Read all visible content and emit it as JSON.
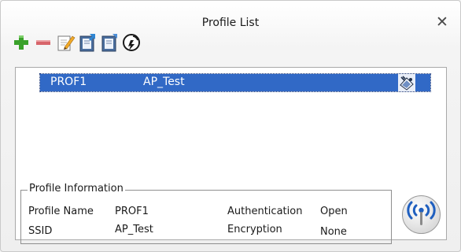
{
  "window": {
    "title": "Profile List",
    "close_symbol": "✕"
  },
  "toolbar": {
    "buttons": [
      {
        "icon": "add-icon",
        "action": "add profile",
        "color": "#3aa12a"
      },
      {
        "icon": "remove-icon",
        "action": "delete profile",
        "color": "#d7646a"
      },
      {
        "icon": "edit-icon",
        "action": "edit profile"
      },
      {
        "icon": "import-icon",
        "action": "import profile"
      },
      {
        "icon": "export-icon",
        "action": "export profile"
      },
      {
        "icon": "activate-icon",
        "action": "activate profile"
      }
    ]
  },
  "profiles": [
    {
      "name": "PROF1",
      "ssid": "AP_Test",
      "status_icon": "connected-link-icon",
      "selected": true
    }
  ],
  "profile_info": {
    "legend": "Profile Information",
    "profile_name_label": "Profile Name",
    "profile_name_value": "PROF1",
    "ssid_label": "SSID",
    "ssid_value": "AP_Test",
    "authentication_label": "Authentication",
    "authentication_value": "Open",
    "encryption_label": "Encryption",
    "encryption_value": "None"
  },
  "connect_button": {
    "icon": "wireless-signal-icon"
  },
  "colors": {
    "selection": "#3169c6",
    "add": "#3aa12a",
    "remove": "#d7646a",
    "wireless_blue": "#1f5fbf"
  }
}
